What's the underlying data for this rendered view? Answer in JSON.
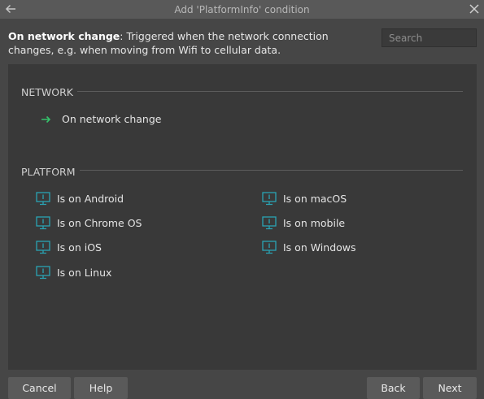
{
  "window": {
    "title": "Add 'PlatformInfo' condition"
  },
  "description": {
    "name": "On network change",
    "text": ": Triggered when the network connection changes, e.g. when moving from Wifi to cellular data."
  },
  "search": {
    "placeholder": "Search",
    "value": ""
  },
  "sections": {
    "network": {
      "title": "NETWORK",
      "items": [
        {
          "label": "On network change",
          "icon": "arrow-right-icon"
        }
      ]
    },
    "platform": {
      "title": "PLATFORM",
      "items": [
        {
          "label": "Is on Android",
          "icon": "monitor-icon"
        },
        {
          "label": "Is on Chrome OS",
          "icon": "monitor-icon"
        },
        {
          "label": "Is on iOS",
          "icon": "monitor-icon"
        },
        {
          "label": "Is on Linux",
          "icon": "monitor-icon"
        },
        {
          "label": "Is on macOS",
          "icon": "monitor-icon"
        },
        {
          "label": "Is on mobile",
          "icon": "monitor-icon"
        },
        {
          "label": "Is on Windows",
          "icon": "monitor-icon"
        }
      ]
    }
  },
  "buttons": {
    "cancel": "Cancel",
    "help": "Help",
    "back": "Back",
    "next": "Next"
  },
  "colors": {
    "accent_green": "#35c26b",
    "icon_teal": "#2aa3b4"
  }
}
